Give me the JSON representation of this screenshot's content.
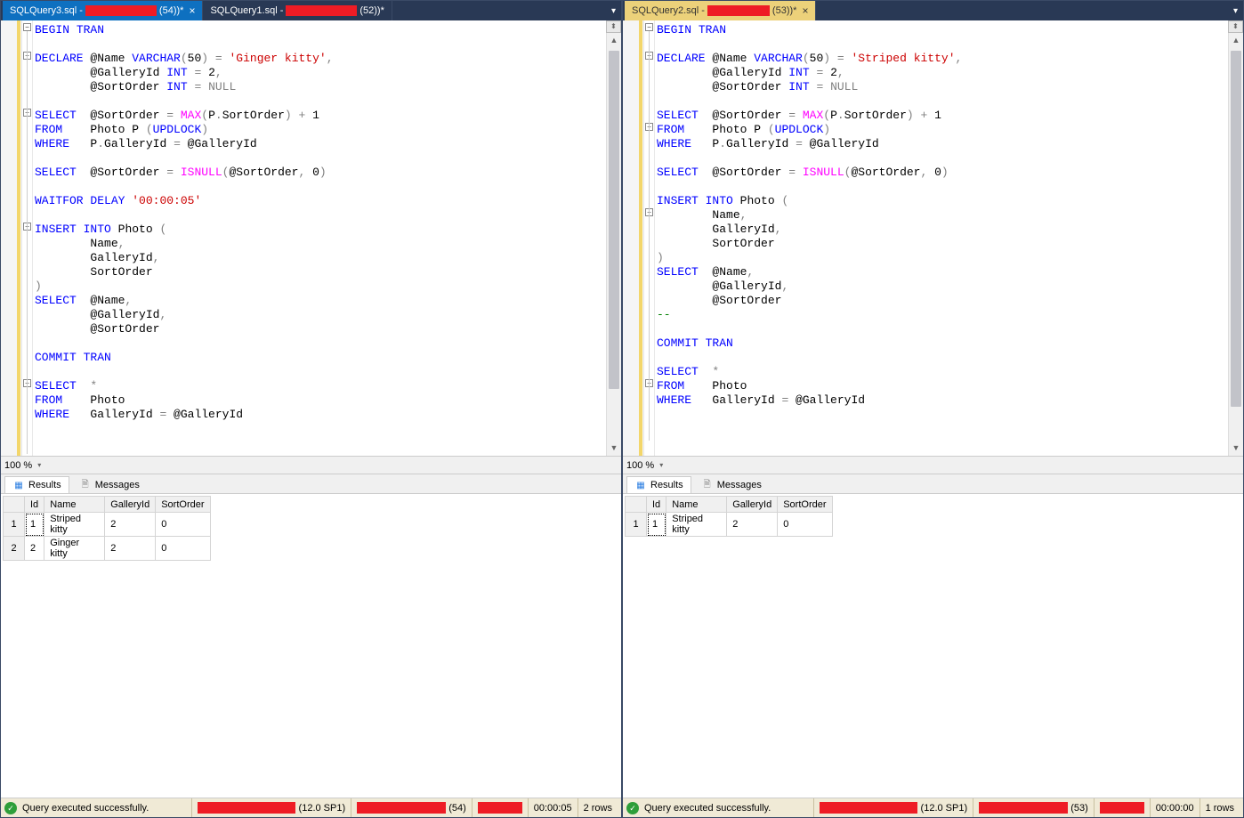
{
  "left": {
    "tabs": [
      {
        "prefix": "SQLQuery3.sql - ",
        "suffix": "(54))*",
        "active": true
      },
      {
        "prefix": "SQLQuery1.sql - ",
        "suffix": "(52))*",
        "active": false
      }
    ],
    "code": {
      "l1_begin": "BEGIN",
      "l1_tran": "TRAN",
      "l3_declare": "DECLARE",
      "l3_at": "@Name ",
      "l3_varchar": "VARCHAR",
      "l3_paren": "(",
      "l3_50": "50",
      "l3_close": ") ",
      "l3_eq": "=",
      "l3_str": " 'Ginger kitty'",
      "l3_comma": ",",
      "l4_at": "@GalleryId ",
      "l4_int": "INT",
      "l4_eq": " = ",
      "l4_val": "2",
      "l4_comma": ",",
      "l5_at": "@SortOrder ",
      "l5_int": "INT",
      "l5_eq": " = ",
      "l5_null": "NULL",
      "l7_select": "SELECT",
      "l7_body": "  @SortOrder ",
      "l7_eq": "=",
      "l7_max": " MAX",
      "l7_paren": "(",
      "l7_p": "P",
      "l7_dot": ".",
      "l7_so": "SortOrder",
      "l7_close": ")",
      "l7_plus": " + ",
      "l7_one": "1",
      "l8_from": "FROM",
      "l8_body": "    Photo P ",
      "l8_paren": "(",
      "l8_upd": "UPDLOCK",
      "l8_close": ")",
      "l9_where": "WHERE",
      "l9_body": "   P",
      "l9_dot": ".",
      "l9_gid": "GalleryId ",
      "l9_eq": "=",
      "l9_at": " @GalleryId",
      "l11_select": "SELECT",
      "l11_body": "  @SortOrder ",
      "l11_eq": "=",
      "l11_isnull": " ISNULL",
      "l11_paren": "(",
      "l11_at": "@SortOrder",
      "l11_comma": ",",
      "l11_zero": " 0",
      "l11_close": ")",
      "l13_waitfor": "WAITFOR",
      "l13_delay": "DELAY",
      "l13_str": " '00:00:05'",
      "l15_insert": "INSERT",
      "l15_into": "INTO",
      "l15_photo": " Photo ",
      "l15_paren": "(",
      "l16": "        Name",
      "l16_comma": ",",
      "l17": "        GalleryId",
      "l17_comma": ",",
      "l18": "        SortOrder",
      "l19": ")",
      "l20_select": "SELECT",
      "l20_at": "  @Name",
      "l20_comma": ",",
      "l21_at": "        @GalleryId",
      "l21_comma": ",",
      "l22_at": "        @SortOrder",
      "l24_commit": "COMMIT",
      "l24_tran": "TRAN",
      "l26_select": "SELECT",
      "l26_star": "  *",
      "l27_from": "FROM",
      "l27_photo": "    Photo",
      "l28_where": "WHERE",
      "l28_body": "   GalleryId ",
      "l28_eq": "=",
      "l28_at": " @GalleryId"
    },
    "zoom": "100 %",
    "res_tabs": {
      "results": "Results",
      "messages": "Messages"
    },
    "grid": {
      "headers": [
        "",
        "Id",
        "Name",
        "GalleryId",
        "SortOrder"
      ],
      "rows": [
        [
          "1",
          "1",
          "Striped kitty",
          "2",
          "0"
        ],
        [
          "2",
          "2",
          "Ginger kitty",
          "2",
          "0"
        ]
      ]
    },
    "status": {
      "msg": "Query executed successfully.",
      "version": "(12.0 SP1)",
      "spid": "(54)",
      "time": "00:00:05",
      "rows": "2 rows"
    }
  },
  "right": {
    "tabs": [
      {
        "prefix": "SQLQuery2.sql - ",
        "suffix": "(53))*",
        "active": true
      }
    ],
    "code": {
      "l1_begin": "BEGIN",
      "l1_tran": "TRAN",
      "l3_declare": "DECLARE",
      "l3_at": "@Name ",
      "l3_varchar": "VARCHAR",
      "l3_paren": "(",
      "l3_50": "50",
      "l3_close": ") ",
      "l3_eq": "=",
      "l3_str": " 'Striped kitty'",
      "l3_comma": ",",
      "l4_at": "@GalleryId ",
      "l4_int": "INT",
      "l4_eq": " = ",
      "l4_val": "2",
      "l4_comma": ",",
      "l5_at": "@SortOrder ",
      "l5_int": "INT",
      "l5_eq": " = ",
      "l5_null": "NULL",
      "l7_select": "SELECT",
      "l7_body": "  @SortOrder ",
      "l7_eq": "=",
      "l7_max": " MAX",
      "l7_paren": "(",
      "l7_p": "P",
      "l7_dot": ".",
      "l7_so": "SortOrder",
      "l7_close": ")",
      "l7_plus": " + ",
      "l7_one": "1",
      "l8_from": "FROM",
      "l8_body": "    Photo P ",
      "l8_paren": "(",
      "l8_upd": "UPDLOCK",
      "l8_close": ")",
      "l9_where": "WHERE",
      "l9_body": "   P",
      "l9_dot": ".",
      "l9_gid": "GalleryId ",
      "l9_eq": "=",
      "l9_at": " @GalleryId",
      "l11_select": "SELECT",
      "l11_body": "  @SortOrder ",
      "l11_eq": "=",
      "l11_isnull": " ISNULL",
      "l11_paren": "(",
      "l11_at": "@SortOrder",
      "l11_comma": ",",
      "l11_zero": " 0",
      "l11_close": ")",
      "l13_insert": "INSERT",
      "l13_into": "INTO",
      "l13_photo": " Photo ",
      "l13_paren": "(",
      "l14": "        Name",
      "l14_comma": ",",
      "l15": "        GalleryId",
      "l15_comma": ",",
      "l16": "        SortOrder",
      "l17": ")",
      "l18_select": "SELECT",
      "l18_at": "  @Name",
      "l18_comma": ",",
      "l19_at": "        @GalleryId",
      "l19_comma": ",",
      "l20_at": "        @SortOrder",
      "l21_dashes": "--",
      "l23_commit": "COMMIT",
      "l23_tran": "TRAN",
      "l25_select": "SELECT",
      "l25_star": "  *",
      "l26_from": "FROM",
      "l26_photo": "    Photo",
      "l27_where": "WHERE",
      "l27_body": "   GalleryId ",
      "l27_eq": "=",
      "l27_at": " @GalleryId"
    },
    "zoom": "100 %",
    "res_tabs": {
      "results": "Results",
      "messages": "Messages"
    },
    "grid": {
      "headers": [
        "",
        "Id",
        "Name",
        "GalleryId",
        "SortOrder"
      ],
      "rows": [
        [
          "1",
          "1",
          "Striped kitty",
          "2",
          "0"
        ]
      ]
    },
    "status": {
      "msg": "Query executed successfully.",
      "version": "(12.0 SP1)",
      "spid": "(53)",
      "time": "00:00:00",
      "rows": "1 rows"
    }
  }
}
